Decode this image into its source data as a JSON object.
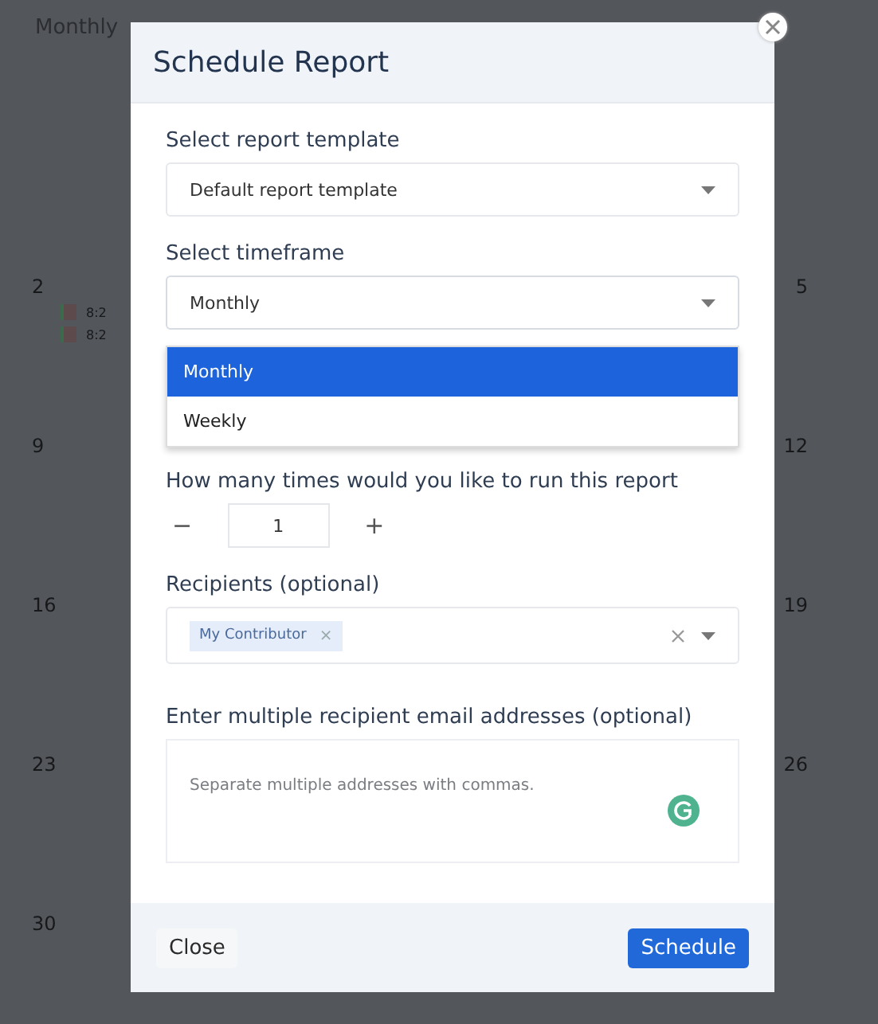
{
  "background": {
    "view": "Monthly",
    "weeks": [
      {
        "left_day": "2",
        "right_day": "5",
        "events": [
          {
            "time": "8:2"
          },
          {
            "time": "8:2"
          }
        ]
      },
      {
        "left_day": "9",
        "right_day": "12"
      },
      {
        "left_day": "16",
        "right_day": "19"
      },
      {
        "left_day": "23",
        "right_day": "26"
      },
      {
        "left_day": "30"
      }
    ]
  },
  "dialog": {
    "title": "Schedule Report",
    "template": {
      "label": "Select report template",
      "value": "Default report template"
    },
    "timeframe": {
      "label": "Select timeframe",
      "value": "Monthly",
      "expanded": true,
      "options": [
        {
          "label": "Monthly",
          "selected": true
        },
        {
          "label": "Weekly",
          "selected": false
        }
      ]
    },
    "runs": {
      "label": "How many times would you like to run this report",
      "minus": "−",
      "value": "1",
      "plus": "+"
    },
    "recipients": {
      "label": "Recipients (optional)",
      "tags": [
        {
          "label": "My Contributor",
          "remove": "×"
        }
      ]
    },
    "emails": {
      "label": "Enter multiple recipient email addresses (optional)",
      "placeholder": "Separate multiple addresses with commas."
    },
    "buttons": [
      {
        "label": "Close",
        "kind": "secondary"
      },
      {
        "label": "Schedule",
        "kind": "primary"
      }
    ]
  }
}
